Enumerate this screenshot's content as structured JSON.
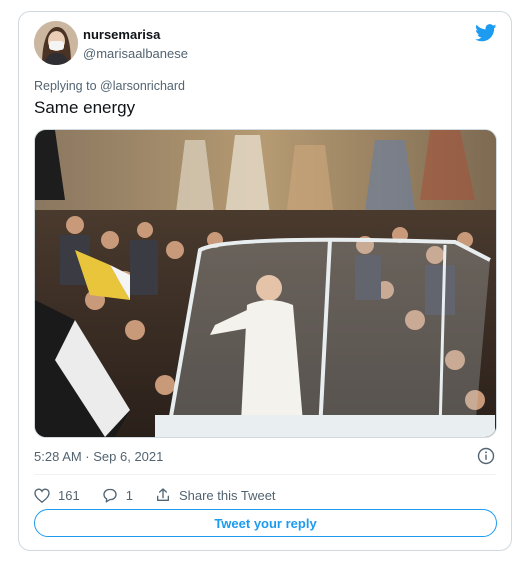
{
  "author": {
    "display_name": "nursemarisa",
    "username": "@marisaalbanese",
    "avatar_icon": "avatar-photo"
  },
  "brand": {
    "icon": "twitter-bird-icon",
    "color": "#1d9bf0"
  },
  "tweet": {
    "replying_prefix": "Replying to",
    "replying_mention": "@larsonrichard",
    "text": "Same energy",
    "timestamp": "5:28 AM · Sep 6, 2021"
  },
  "actions": {
    "like_count": "161",
    "reply_count": "1",
    "share_label": "Share this Tweet"
  },
  "reply_button": {
    "label": "Tweet your reply"
  },
  "colors": {
    "text_secondary": "#536471",
    "border": "#cfd9de",
    "accent": "#1d9bf0"
  }
}
